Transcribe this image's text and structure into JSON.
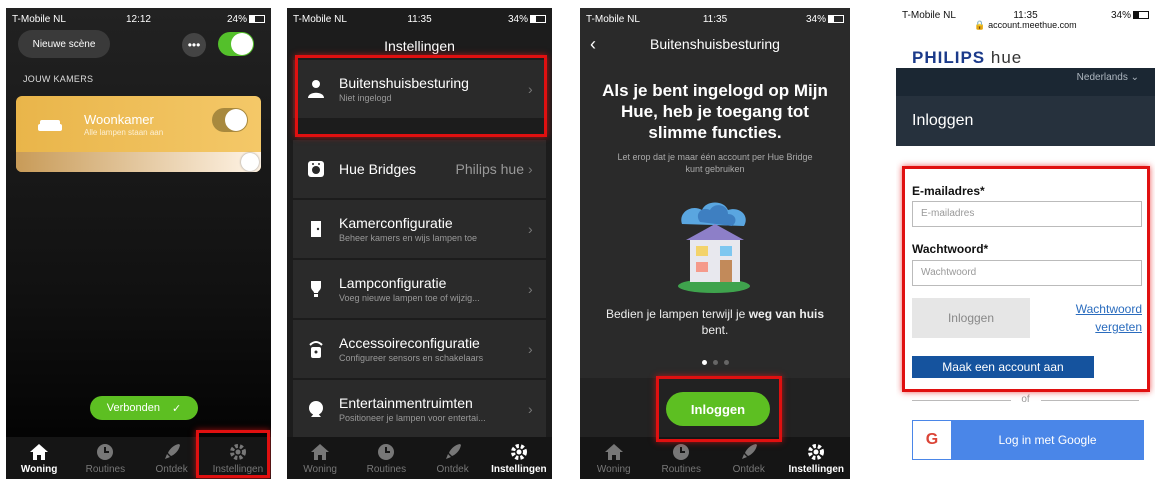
{
  "screen1": {
    "status": {
      "carrier": "T-Mobile NL",
      "time": "12:12",
      "battery": "24%"
    },
    "scene_button": "Nieuwe scène",
    "more_button": "•••",
    "rooms_heading": "JOUW KAMERS",
    "room": {
      "name": "Woonkamer",
      "subtitle": "Alle lampen staan aan"
    },
    "connected_pill": "Verbonden",
    "tabs": [
      "Woning",
      "Routines",
      "Ontdek",
      "Instellingen"
    ]
  },
  "screen2": {
    "status": {
      "carrier": "T-Mobile NL",
      "time": "11:35",
      "battery": "34%"
    },
    "title": "Instellingen",
    "items": [
      {
        "title": "Buitenshuisbesturing",
        "subtitle": "Niet ingelogd",
        "value": ""
      },
      {
        "title": "Hue Bridges",
        "subtitle": "",
        "value": "Philips hue"
      },
      {
        "title": "Kamerconfiguratie",
        "subtitle": "Beheer kamers en wijs lampen toe",
        "value": ""
      },
      {
        "title": "Lampconfiguratie",
        "subtitle": "Voeg nieuwe lampen toe of wijzig...",
        "value": ""
      },
      {
        "title": "Accessoireconfiguratie",
        "subtitle": "Configureer sensors en schakelaars",
        "value": ""
      },
      {
        "title": "Entertainmentruimten",
        "subtitle": "Positioneer je lampen voor entertai...",
        "value": ""
      }
    ],
    "tabs": [
      "Woning",
      "Routines",
      "Ontdek",
      "Instellingen"
    ]
  },
  "screen3": {
    "status": {
      "carrier": "T-Mobile NL",
      "time": "11:35",
      "battery": "34%"
    },
    "title": "Buitenshuisbesturing",
    "headline": "Als je bent ingelogd op Mijn Hue, heb je toegang tot slimme functies.",
    "subtext": "Let erop dat je maar één account per Hue Bridge kunt gebruiken",
    "desc_prefix": "Bedien je lampen terwijl je ",
    "desc_bold": "weg van huis",
    "desc_suffix": " bent.",
    "login_button": "Inloggen",
    "tabs": [
      "Woning",
      "Routines",
      "Ontdek",
      "Instellingen"
    ]
  },
  "screen4": {
    "status": {
      "carrier": "T-Mobile NL",
      "time": "11:35",
      "battery": "34%"
    },
    "url": "account.meethue.com",
    "logo": {
      "brand": "PHILIPS",
      "product": "hue"
    },
    "language": "Nederlands",
    "heading": "Inloggen",
    "email_label": "E-mailadres*",
    "email_placeholder": "E-mailadres",
    "password_label": "Wachtwoord*",
    "password_placeholder": "Wachtwoord",
    "login_button": "Inloggen",
    "forgot_line1": "Wachtwoord",
    "forgot_line2": "vergeten",
    "create_account": "Maak een account aan",
    "or_text": "of",
    "google_letter": "G",
    "google_button": "Log in met Google"
  },
  "colors": {
    "accent_green": "#5dbf22",
    "highlight_red": "#e01010",
    "hue_blue": "#15539e"
  }
}
